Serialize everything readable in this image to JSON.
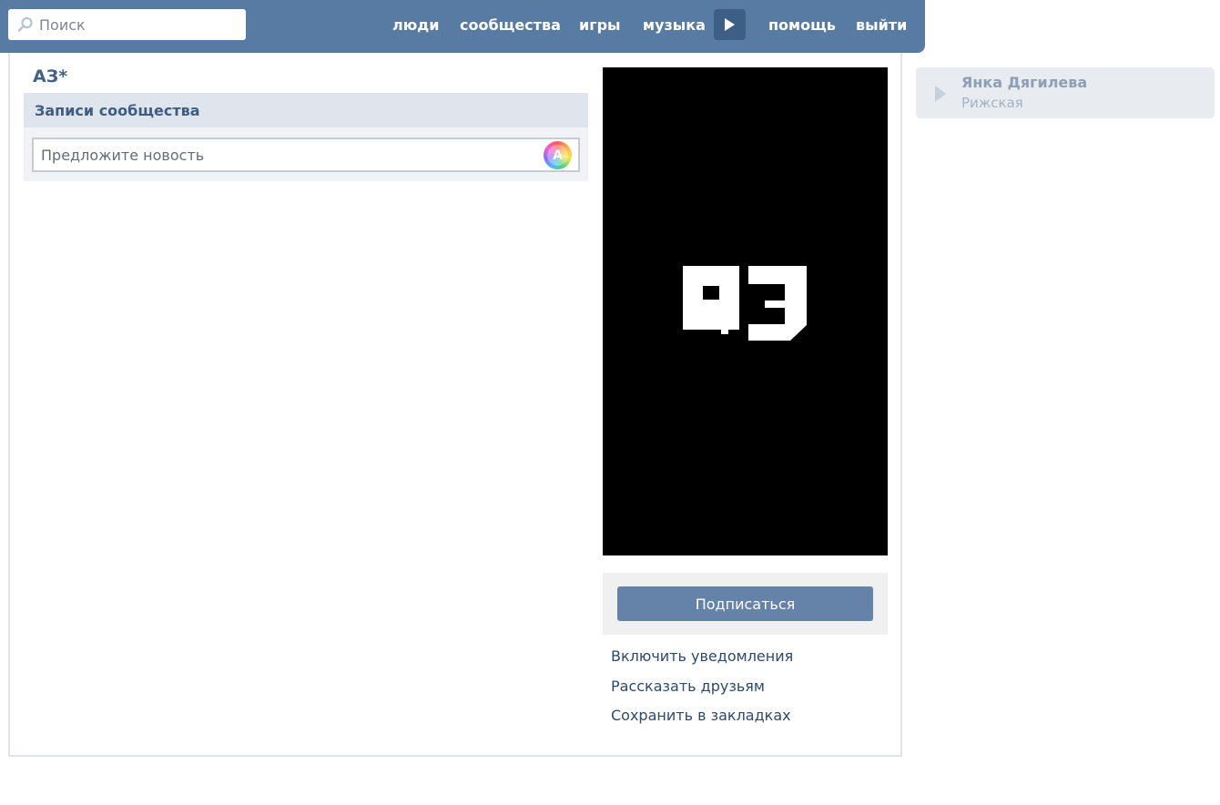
{
  "header": {
    "search_placeholder": "Поиск",
    "nav": {
      "people": "люди",
      "communities": "сообщества",
      "games": "игры",
      "music": "музыка",
      "help": "помощь",
      "logout": "выйти"
    }
  },
  "group": {
    "title": "АЗ*",
    "cover_text": "АЗ"
  },
  "wall": {
    "header": "Записи сообщества",
    "suggest_placeholder": "Предложите новость",
    "poster_icon_letter": "A"
  },
  "sidebar": {
    "subscribe_label": "Подписаться",
    "actions": [
      {
        "label": "Включить уведомления"
      },
      {
        "label": "Рассказать друзьям"
      },
      {
        "label": "Сохранить в закладках"
      }
    ]
  },
  "now_playing": {
    "artist": "Янка Дягилева",
    "track": "Рижская"
  },
  "colors": {
    "header_bg": "#587ba3",
    "button_bg": "#6583a8",
    "link": "#2d4a6b"
  }
}
